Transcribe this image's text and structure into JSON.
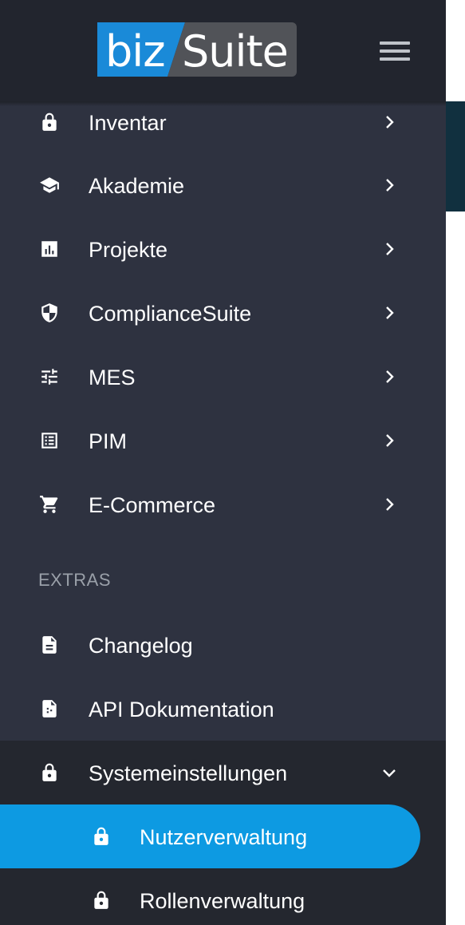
{
  "brand": {
    "logo_part1": "biz",
    "logo_part2": "Suite",
    "blue": "#1a8ad8",
    "grey": "#515358"
  },
  "colors": {
    "sidebar_bg": "#2e3240",
    "topbar_bg": "#22252e",
    "active_bg": "#0d9ae2",
    "submenu_bg": "#24272f"
  },
  "menu": {
    "items": [
      {
        "label": "Inventar",
        "icon": "lock-icon"
      },
      {
        "label": "Akademie",
        "icon": "graduation-cap-icon"
      },
      {
        "label": "Projekte",
        "icon": "bar-chart-icon"
      },
      {
        "label": "ComplianceSuite",
        "icon": "shield-icon"
      },
      {
        "label": "MES",
        "icon": "sliders-icon"
      },
      {
        "label": "PIM",
        "icon": "list-box-icon"
      },
      {
        "label": "E-Commerce",
        "icon": "shopping-cart-icon"
      }
    ],
    "extras_heading": "EXTRAS",
    "extras": [
      {
        "label": "Changelog",
        "icon": "document-icon"
      },
      {
        "label": "API Dokumentation",
        "icon": "api-document-icon"
      },
      {
        "label": "Systemeinstellungen",
        "icon": "lock-icon"
      }
    ],
    "submenu": [
      {
        "label": "Nutzerverwaltung",
        "icon": "lock-icon",
        "active": true
      },
      {
        "label": "Rollenverwaltung",
        "icon": "lock-icon",
        "active": false
      }
    ]
  }
}
